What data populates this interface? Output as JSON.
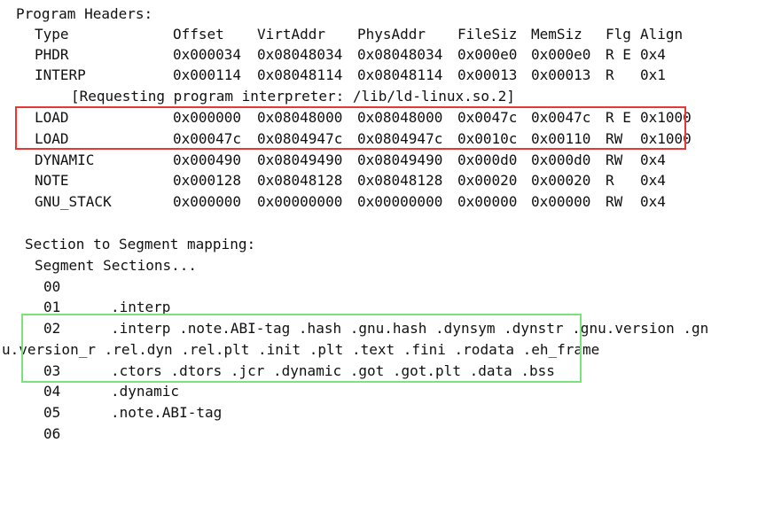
{
  "terminal": {
    "program_headers_title": "Program Headers:",
    "columns": [
      "Type",
      "Offset",
      "VirtAddr",
      "PhysAddr",
      "FileSiz",
      "MemSiz",
      "Flg",
      "Align"
    ],
    "rows": [
      {
        "type": "PHDR",
        "offset": "0x000034",
        "virt": "0x08048034",
        "phys": "0x08048034",
        "filesiz": "0x000e0",
        "memsiz": "0x000e0",
        "flg": "R E",
        "align": "0x4"
      },
      {
        "type": "INTERP",
        "offset": "0x000114",
        "virt": "0x08048114",
        "phys": "0x08048114",
        "filesiz": "0x00013",
        "memsiz": "0x00013",
        "flg": "R",
        "align": "0x1"
      },
      {
        "type": "LOAD",
        "offset": "0x000000",
        "virt": "0x08048000",
        "phys": "0x08048000",
        "filesiz": "0x0047c",
        "memsiz": "0x0047c",
        "flg": "R E",
        "align": "0x1000"
      },
      {
        "type": "LOAD",
        "offset": "0x00047c",
        "virt": "0x0804947c",
        "phys": "0x0804947c",
        "filesiz": "0x0010c",
        "memsiz": "0x00110",
        "flg": "RW",
        "align": "0x1000"
      },
      {
        "type": "DYNAMIC",
        "offset": "0x000490",
        "virt": "0x08049490",
        "phys": "0x08049490",
        "filesiz": "0x000d0",
        "memsiz": "0x000d0",
        "flg": "RW",
        "align": "0x4"
      },
      {
        "type": "NOTE",
        "offset": "0x000128",
        "virt": "0x08048128",
        "phys": "0x08048128",
        "filesiz": "0x00020",
        "memsiz": "0x00020",
        "flg": "R",
        "align": "0x4"
      },
      {
        "type": "GNU_STACK",
        "offset": "0x000000",
        "virt": "0x00000000",
        "phys": "0x00000000",
        "filesiz": "0x00000",
        "memsiz": "0x00000",
        "flg": "RW",
        "align": "0x4"
      }
    ],
    "interp_note": "[Requesting program interpreter: /lib/ld-linux.so.2]",
    "mapping_title": "Section to Segment mapping:",
    "mapping_header": "Segment Sections...",
    "segments": [
      {
        "num": "00",
        "sections": ""
      },
      {
        "num": "01",
        "sections": ".interp"
      },
      {
        "num": "02",
        "sections": ".interp .note.ABI-tag .hash .gnu.hash .dynsym .dynstr .gnu.version .gn"
      },
      {
        "num": "",
        "sections": "u.version_r .rel.dyn .rel.plt .init .plt .text .fini .rodata .eh_frame"
      },
      {
        "num": "03",
        "sections": ".ctors .dtors .jcr .dynamic .got .got.plt .data .bss"
      },
      {
        "num": "04",
        "sections": ".dynamic"
      },
      {
        "num": "05",
        "sections": ".note.ABI-tag"
      },
      {
        "num": "06",
        "sections": ""
      }
    ],
    "highlight_colors": {
      "load_rows_box": "#e53935",
      "segment_box": "#7be37b"
    }
  }
}
